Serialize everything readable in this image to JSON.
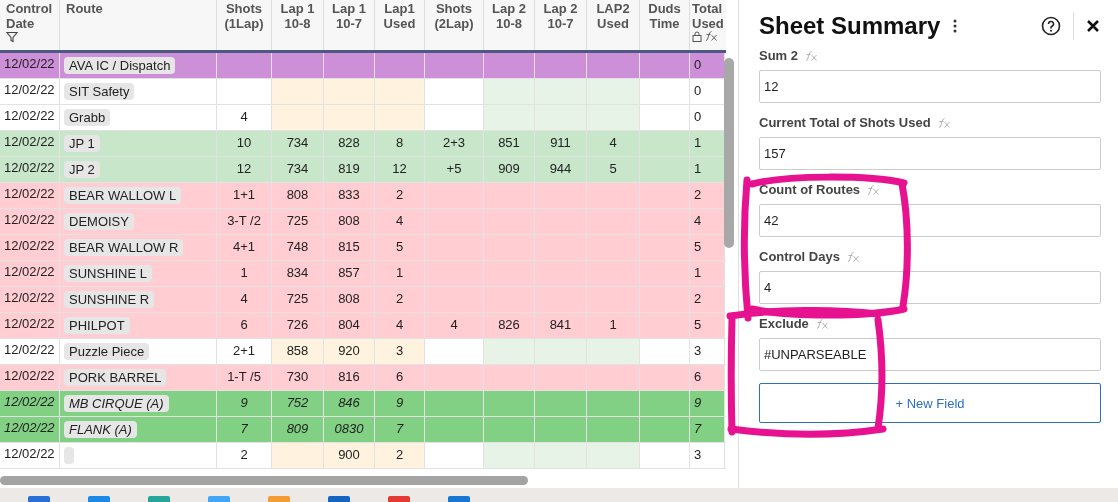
{
  "table": {
    "columns": [
      {
        "label": "Control Date",
        "kind": "date"
      },
      {
        "label": "Route",
        "kind": "route"
      },
      {
        "label": "Shots (1Lap)",
        "kind": "plain"
      },
      {
        "label": "Lap 1 10-8",
        "kind": "lap1"
      },
      {
        "label": "Lap 1 10-7",
        "kind": "lap1"
      },
      {
        "label": "Lap1 Used",
        "kind": "lap1"
      },
      {
        "label": "Shots (2Lap)",
        "kind": "plain"
      },
      {
        "label": "Lap 2 10-8",
        "kind": "lap2"
      },
      {
        "label": "Lap 2 10-7",
        "kind": "lap2"
      },
      {
        "label": "LAP2 Used",
        "kind": "lap2"
      },
      {
        "label": "Duds Time",
        "kind": "plain"
      },
      {
        "label": "Total Used",
        "kind": "total"
      }
    ],
    "rows": [
      {
        "color": "#ce8fd9",
        "italic": false,
        "cells": [
          "12/02/22",
          "AVA IC / Dispatch",
          null,
          null,
          null,
          null,
          null,
          null,
          null,
          null,
          null,
          "0"
        ]
      },
      {
        "italic": false,
        "cells": [
          "12/02/22",
          "SIT Safety",
          null,
          null,
          null,
          null,
          null,
          null,
          null,
          null,
          null,
          "0"
        ]
      },
      {
        "italic": false,
        "cells": [
          "12/02/22",
          "Grabb",
          "4",
          null,
          null,
          null,
          null,
          null,
          null,
          null,
          null,
          "0"
        ]
      },
      {
        "color": "#c8e6c9",
        "italic": false,
        "cells": [
          "12/02/22",
          "JP 1",
          "10",
          "734",
          "828",
          "8",
          "2+3",
          "851",
          "911",
          "4",
          null,
          "1"
        ]
      },
      {
        "color": "#c8e6c9",
        "italic": false,
        "cells": [
          "12/02/22",
          "JP 2",
          "12",
          "734",
          "819",
          "12",
          "+5",
          "909",
          "944",
          "5",
          null,
          "1"
        ]
      },
      {
        "color": "#ffcdd2",
        "italic": false,
        "cells": [
          "12/02/22",
          "BEAR WALLOW L",
          "1+1",
          "808",
          "833",
          "2",
          null,
          null,
          null,
          null,
          null,
          "2"
        ]
      },
      {
        "color": "#ffcdd2",
        "italic": false,
        "cells": [
          "12/02/22",
          "DEMOISY",
          "3-T /2",
          "725",
          "808",
          "4",
          null,
          null,
          null,
          null,
          null,
          "4"
        ]
      },
      {
        "color": "#ffcdd2",
        "italic": false,
        "cells": [
          "12/02/22",
          "BEAR WALLOW R",
          "4+1",
          "748",
          "815",
          "5",
          null,
          null,
          null,
          null,
          null,
          "5"
        ]
      },
      {
        "color": "#ffcdd2",
        "italic": false,
        "cells": [
          "12/02/22",
          "SUNSHINE L",
          "1",
          "834",
          "857",
          "1",
          null,
          null,
          null,
          null,
          null,
          "1"
        ]
      },
      {
        "color": "#ffcdd2",
        "italic": false,
        "cells": [
          "12/02/22",
          "SUNSHINE R",
          "4",
          "725",
          "808",
          "2",
          null,
          null,
          null,
          null,
          null,
          "2"
        ]
      },
      {
        "color": "#ffcdd2",
        "italic": false,
        "cells": [
          "12/02/22",
          "PHILPOT",
          "6",
          "726",
          "804",
          "4",
          "4",
          "826",
          "841",
          "1",
          null,
          "5"
        ]
      },
      {
        "italic": false,
        "cells": [
          "12/02/22",
          "Puzzle Piece",
          "2+1",
          "858",
          "920",
          "3",
          null,
          null,
          null,
          null,
          null,
          "3"
        ]
      },
      {
        "color": "#ffcdd2",
        "italic": false,
        "cells": [
          "12/02/22",
          "PORK BARREL",
          "1-T /5",
          "730",
          "816",
          "6",
          null,
          null,
          null,
          null,
          null,
          "6"
        ]
      },
      {
        "color": "#81d083",
        "italic": true,
        "cells": [
          "12/02/22",
          "MB CIRQUE (A)",
          "9",
          "752",
          "846",
          "9",
          null,
          null,
          null,
          null,
          null,
          "9"
        ]
      },
      {
        "color": "#81d083",
        "italic": true,
        "cells": [
          "12/02/22",
          "FLANK (A)",
          "7",
          "809",
          "0830",
          "7",
          null,
          null,
          null,
          null,
          null,
          "7"
        ]
      },
      {
        "italic": false,
        "cells": [
          "12/02/22",
          null,
          "2",
          null,
          "900",
          "2",
          null,
          null,
          null,
          null,
          null,
          "3"
        ]
      }
    ]
  },
  "panel": {
    "title": "Sheet Summary",
    "fields": [
      {
        "label": "Sum 2",
        "value": "12"
      },
      {
        "label": "Current Total of Shots Used",
        "value": "157"
      },
      {
        "label": "Count of Routes",
        "value": "42"
      },
      {
        "label": "Control Days",
        "value": "4"
      },
      {
        "label": "Exclude",
        "value": "#UNPARSEABLE"
      }
    ],
    "new_field_button": "+ New Field"
  }
}
